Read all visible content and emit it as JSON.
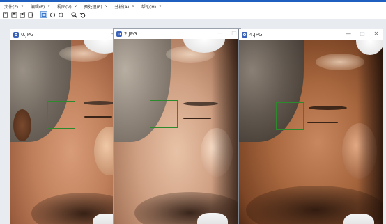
{
  "menu": [
    {
      "label": "文件(F)"
    },
    {
      "label": "编辑(E)"
    },
    {
      "label": "视图(V)"
    },
    {
      "label": "预处理(P)"
    },
    {
      "label": "分析(A)"
    },
    {
      "label": "帮助(H)"
    }
  ],
  "toolbar": {
    "icons": [
      "new-icon",
      "save-icon",
      "save-as-icon",
      "export-icon",
      "rectangle-icon",
      "ellipse-icon",
      "polygon-icon",
      "zoom-icon",
      "undo-icon"
    ],
    "active_tool": "rectangle-icon"
  },
  "windows": [
    {
      "title": "0.JPG"
    },
    {
      "title": "2.JPG"
    },
    {
      "title": "4.JPG"
    }
  ],
  "colors": {
    "accent": "#1f5fbf",
    "roi_green": "#2c8a2c",
    "window_icon": "#3a62b8"
  }
}
